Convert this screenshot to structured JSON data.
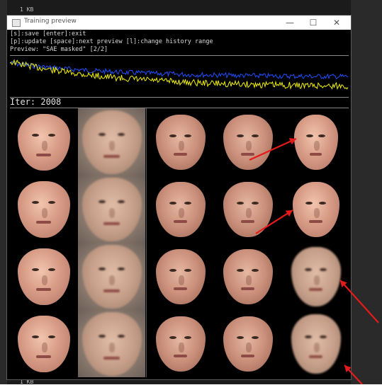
{
  "kb_top": "1 KB",
  "kb_bottom": "1 KB",
  "window": {
    "title": "Training preview",
    "minimize_glyph": "—",
    "maximize_glyph": "☐",
    "close_glyph": "✕"
  },
  "console": {
    "line1": "[s]:save [enter]:exit",
    "line2": "[p]:update [space]:next preview [l]:change history range",
    "line3": "Preview: \"SAE masked\" [2/2]"
  },
  "loss_graph": {
    "colors": {
      "yellow": "#f2f200",
      "blue": "#1f4fff"
    }
  },
  "iteration": "Iter: 2008",
  "annotations": {
    "arrow_color": "#e51b1b"
  }
}
